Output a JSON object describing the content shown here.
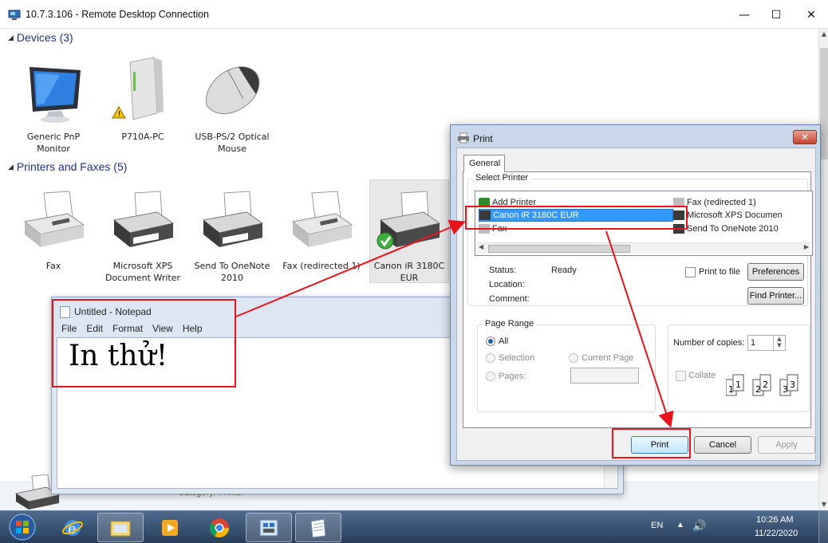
{
  "rdp": {
    "title": "10.7.3.106 - Remote Desktop Connection",
    "minimize": "—",
    "maximize": "☐",
    "close": "✕"
  },
  "devices": {
    "header": "Devices (3)",
    "items": [
      {
        "label": "Generic PnP Monitor",
        "icon": "monitor-icon"
      },
      {
        "label": "P710A-PC",
        "icon": "computer-tower-icon"
      },
      {
        "label": "USB-PS/2 Optical Mouse",
        "icon": "mouse-icon"
      }
    ]
  },
  "printers": {
    "header": "Printers and Faxes (5)",
    "items": [
      {
        "label": "Fax",
        "icon": "fax-icon"
      },
      {
        "label": "Microsoft XPS Document Writer",
        "icon": "printer-icon"
      },
      {
        "label": "Send To OneNote 2010",
        "icon": "printer-icon"
      },
      {
        "label": "Fax (redirected 1)",
        "icon": "fax-icon"
      },
      {
        "label": "Canon iR 3180C EUR",
        "icon": "printer-default-icon"
      }
    ]
  },
  "footer": {
    "category": "Category: Printer"
  },
  "notepad": {
    "title": "Untitled - Notepad",
    "menu": [
      "File",
      "Edit",
      "Format",
      "View",
      "Help"
    ],
    "text": "In thử!"
  },
  "print_dialog": {
    "title": "Print",
    "close": "✕",
    "tab": "General",
    "select_printer_legend": "Select Printer",
    "printers_left": [
      "Add Printer",
      "Canon iR 3180C EUR",
      "Fax"
    ],
    "printers_right": [
      "Fax (redirected 1)",
      "Microsoft XPS Documen",
      "Send To OneNote 2010"
    ],
    "status_label": "Status:",
    "status_value": "Ready",
    "location_label": "Location:",
    "comment_label": "Comment:",
    "print_to_file": "Print to file",
    "preferences": "Preferences",
    "find_printer": "Find Printer...",
    "page_range_legend": "Page Range",
    "all": "All",
    "selection": "Selection",
    "current_page": "Current Page",
    "pages": "Pages:",
    "copies_label": "Number of copies:",
    "copies_value": "1",
    "collate": "Collate",
    "print_button": "Print",
    "cancel_button": "Cancel",
    "apply_button": "Apply"
  },
  "taskbar": {
    "language": "EN",
    "time": "10:26 AM",
    "date": "11/22/2020"
  },
  "colors": {
    "annotation": "#e8141b",
    "group_header": "#1e3287",
    "taskbar": "#34506f"
  }
}
